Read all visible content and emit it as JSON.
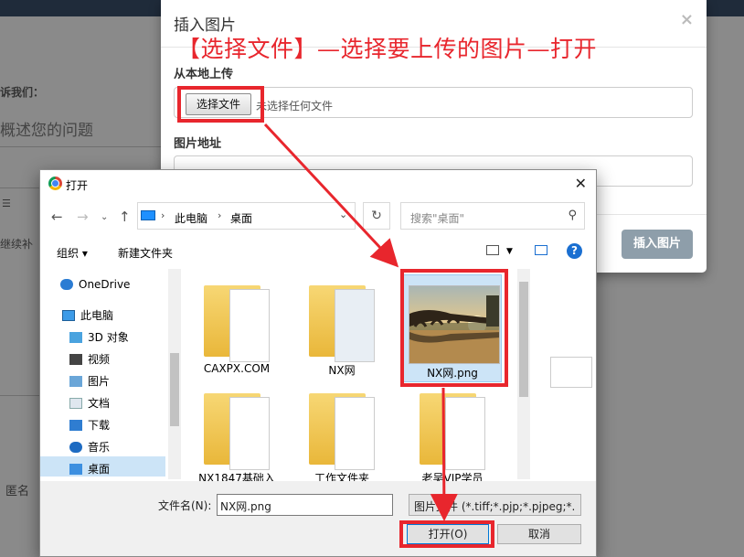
{
  "background": {
    "contact_label": "诉我们：",
    "problem_placeholder": "概述您的问题",
    "continue_text": "继续补",
    "anonymous_label": "匿名"
  },
  "modal": {
    "title": "插入图片",
    "close": "×",
    "annotation": "【选择文件】—选择要上传的图片—打开",
    "local_upload_label": "从本地上传",
    "choose_file_button": "选择文件",
    "no_file_text": "未选择任何文件",
    "image_url_label": "图片地址",
    "insert_button": "插入图片"
  },
  "dialog": {
    "title": "打开",
    "close": "✕",
    "breadcrumb": [
      "此电脑",
      "桌面"
    ],
    "search_placeholder": "搜索\"桌面\"",
    "organize": "组织 ▾",
    "new_folder": "新建文件夹",
    "nav_items": [
      {
        "label": "OneDrive",
        "icon": "cloud-icon"
      },
      {
        "label": "此电脑",
        "icon": "computer-icon"
      },
      {
        "label": "3D 对象",
        "icon": "cube-icon"
      },
      {
        "label": "视频",
        "icon": "video-icon"
      },
      {
        "label": "图片",
        "icon": "picture-icon"
      },
      {
        "label": "文档",
        "icon": "document-icon"
      },
      {
        "label": "下载",
        "icon": "download-icon"
      },
      {
        "label": "音乐",
        "icon": "music-icon"
      },
      {
        "label": "桌面",
        "icon": "desktop-icon"
      }
    ],
    "files": [
      {
        "label": "CAXPX.COM"
      },
      {
        "label": "NX网"
      },
      {
        "label": "NX网.png"
      },
      {
        "label": "NX1847基础入"
      },
      {
        "label": "工作文件夹"
      },
      {
        "label": "老吴VIP学员"
      }
    ],
    "filename_label": "文件名(N):",
    "filename_value": "NX网.png",
    "filetype_value": "图片文件 (*.tiff;*.pjp;*.pjpeg;*.",
    "open_button": "打开(O)",
    "cancel_button": "取消"
  },
  "colors": {
    "annotation_red": "#e8262d",
    "selection_blue": "#cce4f7",
    "insert_button_bg": "#8e9eaa"
  }
}
